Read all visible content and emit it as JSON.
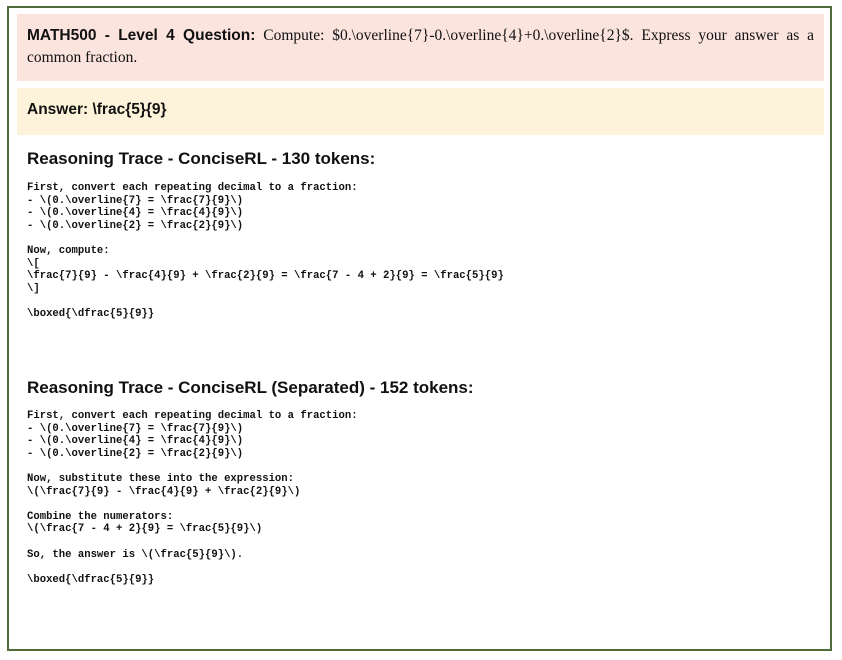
{
  "question": {
    "label": "MATH500 - Level 4 Question:",
    "text": " Compute: $0.\\overline{7}-0.\\overline{4}+0.\\overline{2}$. Express your answer as a common fraction."
  },
  "answer": {
    "text": "Answer: \\frac{5}{9}"
  },
  "traces": [
    {
      "heading": "Reasoning Trace - ConciseRL - 130 tokens:",
      "body": "First, convert each repeating decimal to a fraction:\n- \\(0.\\overline{7} = \\frac{7}{9}\\)\n- \\(0.\\overline{4} = \\frac{4}{9}\\)\n- \\(0.\\overline{2} = \\frac{2}{9}\\)\n\nNow, compute:\n\\[\n\\frac{7}{9} - \\frac{4}{9} + \\frac{2}{9} = \\frac{7 - 4 + 2}{9} = \\frac{5}{9}\n\\]\n\n\\boxed{\\dfrac{5}{9}}"
    },
    {
      "heading": "Reasoning Trace - ConciseRL (Separated) - 152 tokens:",
      "body": "First, convert each repeating decimal to a fraction:\n- \\(0.\\overline{7} = \\frac{7}{9}\\)\n- \\(0.\\overline{4} = \\frac{4}{9}\\)\n- \\(0.\\overline{2} = \\frac{2}{9}\\)\n\nNow, substitute these into the expression:\n\\(\\frac{7}{9} - \\frac{4}{9} + \\frac{2}{9}\\)\n\nCombine the numerators:\n\\(\\frac{7 - 4 + 2}{9} = \\frac{5}{9}\\)\n\nSo, the answer is \\(\\frac{5}{9}\\).\n\n\\boxed{\\dfrac{5}{9}}"
    }
  ]
}
